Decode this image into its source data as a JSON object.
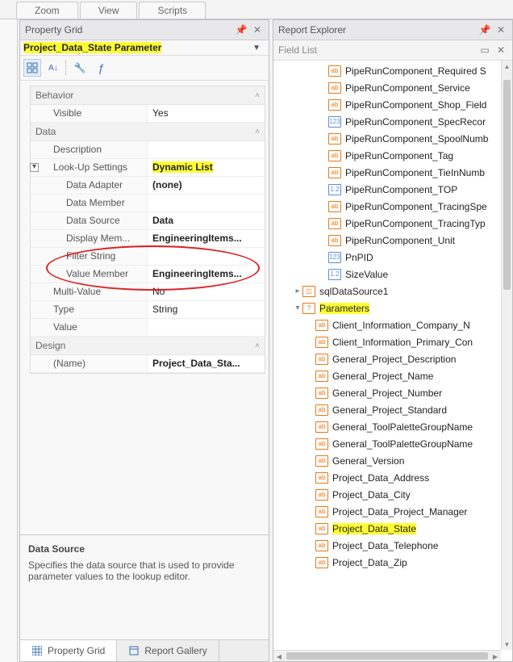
{
  "top_tabs": {
    "zoom": "Zoom",
    "view": "View",
    "scripts": "Scripts"
  },
  "pg": {
    "title": "Property Grid",
    "subject": "Project_Data_State   Parameter",
    "cat_behavior": "Behavior",
    "cat_data": "Data",
    "cat_design": "Design",
    "rows": {
      "visible_l": "Visible",
      "visible_v": "Yes",
      "description_l": "Description",
      "description_v": "",
      "lookup_l": "Look-Up Settings",
      "lookup_v": "Dynamic List",
      "adapter_l": "Data Adapter",
      "adapter_v": "(none)",
      "member_l": "Data Member",
      "member_v": "",
      "source_l": "Data Source",
      "source_v": "Data",
      "display_l": "Display Mem...",
      "display_v": "EngineeringItems...",
      "filter_l": "Filter String",
      "filter_v": "",
      "valuemem_l": "Value Member",
      "valuemem_v": "EngineeringItems...",
      "multi_l": "Multi-Value",
      "multi_v": "No",
      "type_l": "Type",
      "type_v": "String",
      "value_l": "Value",
      "value_v": "",
      "name_l": "(Name)",
      "name_v": "Project_Data_Sta..."
    },
    "desc_title": "Data Source",
    "desc_body": "Specifies the data source that is used to provide parameter values to the lookup editor.",
    "tab_pg": "Property Grid",
    "tab_rg": "Report Gallery"
  },
  "re": {
    "title": "Report Explorer",
    "sub": "Field List",
    "items": [
      {
        "ind": 3,
        "icon": "ab",
        "label": "PipeRunComponent_Required S"
      },
      {
        "ind": 3,
        "icon": "ab",
        "label": "PipeRunComponent_Service"
      },
      {
        "ind": 3,
        "icon": "ab",
        "label": "PipeRunComponent_Shop_Field"
      },
      {
        "ind": 3,
        "icon": "123",
        "label": "PipeRunComponent_SpecRecor"
      },
      {
        "ind": 3,
        "icon": "ab",
        "label": "PipeRunComponent_SpoolNumb"
      },
      {
        "ind": 3,
        "icon": "ab",
        "label": "PipeRunComponent_Tag"
      },
      {
        "ind": 3,
        "icon": "ab",
        "label": "PipeRunComponent_TieInNumb"
      },
      {
        "ind": 3,
        "icon": "1.2",
        "label": "PipeRunComponent_TOP"
      },
      {
        "ind": 3,
        "icon": "ab",
        "label": "PipeRunComponent_TracingSpe"
      },
      {
        "ind": 3,
        "icon": "ab",
        "label": "PipeRunComponent_TracingTyp"
      },
      {
        "ind": 3,
        "icon": "ab",
        "label": "PipeRunComponent_Unit"
      },
      {
        "ind": 3,
        "icon": "123",
        "label": "PnPID"
      },
      {
        "ind": 3,
        "icon": "1.2",
        "label": "SizeValue"
      },
      {
        "ind": 1,
        "icon": "db",
        "label": "sqlDataSource1",
        "toggle": "▸"
      },
      {
        "ind": 1,
        "icon": "?",
        "label": "Parameters",
        "toggle": "▾",
        "hl": true
      },
      {
        "ind": 2,
        "icon": "ab",
        "label": "Client_Information_Company_N"
      },
      {
        "ind": 2,
        "icon": "ab",
        "label": "Client_Information_Primary_Con"
      },
      {
        "ind": 2,
        "icon": "ab",
        "label": "General_Project_Description"
      },
      {
        "ind": 2,
        "icon": "ab",
        "label": "General_Project_Name"
      },
      {
        "ind": 2,
        "icon": "ab",
        "label": "General_Project_Number"
      },
      {
        "ind": 2,
        "icon": "ab",
        "label": "General_Project_Standard"
      },
      {
        "ind": 2,
        "icon": "ab",
        "label": "General_ToolPaletteGroupName"
      },
      {
        "ind": 2,
        "icon": "ab",
        "label": "General_ToolPaletteGroupName"
      },
      {
        "ind": 2,
        "icon": "ab",
        "label": "General_Version"
      },
      {
        "ind": 2,
        "icon": "ab",
        "label": "Project_Data_Address"
      },
      {
        "ind": 2,
        "icon": "ab",
        "label": "Project_Data_City"
      },
      {
        "ind": 2,
        "icon": "ab",
        "label": "Project_Data_Project_Manager"
      },
      {
        "ind": 2,
        "icon": "ab",
        "label": "Project_Data_State",
        "hl": true
      },
      {
        "ind": 2,
        "icon": "ab",
        "label": "Project_Data_Telephone"
      },
      {
        "ind": 2,
        "icon": "ab",
        "label": "Project_Data_Zip"
      }
    ]
  }
}
